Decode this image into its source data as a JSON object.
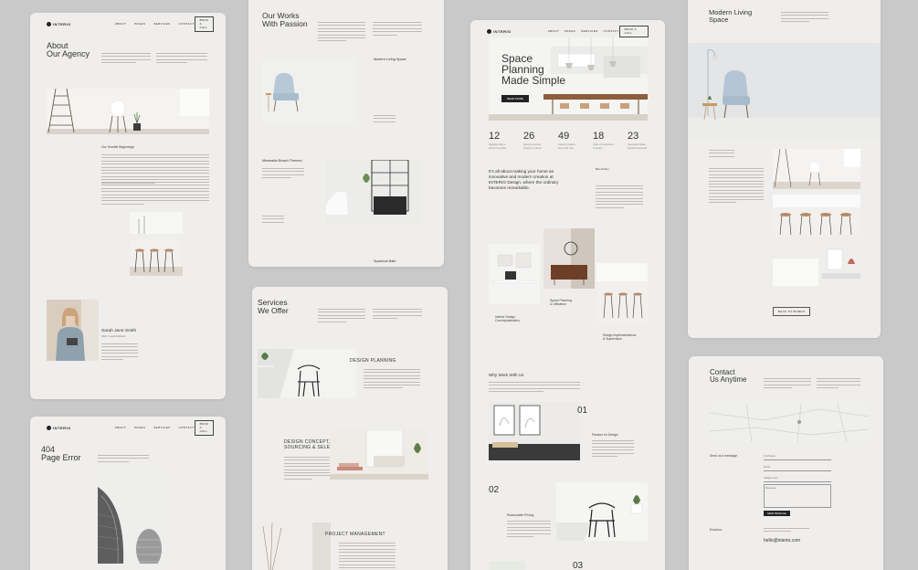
{
  "brand": {
    "logo": "INTERIO"
  },
  "nav": {
    "links": [
      "ABOUT",
      "PAGES",
      "SERVICES",
      "CONTACT"
    ],
    "cta": "BOOK A CALL"
  },
  "about": {
    "title_l1": "About",
    "title_l2": "Our Agency",
    "subheading": "Our Humble Beginnings",
    "person_name": "Sarah Jane Smith",
    "person_role": "CEO / Lead Architect"
  },
  "error404": {
    "title_l1": "404",
    "title_l2": "Page Error"
  },
  "works": {
    "title_l1": "Our Works",
    "title_l2": "With Passion",
    "project1": "Modern Living Space",
    "project2": "Minimalist Beach Themed",
    "project3": "Spacious Bath"
  },
  "services": {
    "title_l1": "Services",
    "title_l2": "We Offer",
    "s1": "DESIGN PLANNING",
    "s2_l1": "DESIGN CONCEPT,",
    "s2_l2": "SOURCING & SELECTION",
    "s3": "PROJECT MANAGEMENT"
  },
  "home": {
    "hero_l1": "Space",
    "hero_l2": "Planning",
    "hero_l3": "Made Simple",
    "hero_button": "READ MORE",
    "stats": [
      {
        "num": "12",
        "txt": "Satisfied clients across the globe"
      },
      {
        "num": "26",
        "txt": "Awards received during our career"
      },
      {
        "num": "49",
        "txt": "Custom projects done with care"
      },
      {
        "num": "18",
        "txt": "Years of experience in design"
      },
      {
        "num": "23",
        "txt": "Successful ideas launched and built"
      }
    ],
    "intro_l1": "It's all about making your home an",
    "intro_l2": "innovative and modern creation at",
    "intro_l3": "INTERIO Design, where the ordinary",
    "intro_l4": "becomes remarkable.",
    "side_heading": "Biomimikry",
    "tile1_l1": "Interior Design",
    "tile1_l2": "Conceptualization",
    "tile2_l1": "Space Planning",
    "tile2_l2": "& Utilization",
    "tile3_l1": "Design Implementations",
    "tile3_l2": "& Supervision",
    "why": "Why Work With Us",
    "n01": "01",
    "f1": "Passion for Design",
    "n02": "02",
    "f2": "Reasonable Pricing",
    "n03": "03"
  },
  "project": {
    "title_l1": "Modern Living",
    "title_l2": "Space",
    "button": "BACK TO WORKS"
  },
  "contact": {
    "title_l1": "Contact",
    "title_l2": "Us Anytime",
    "send": "Send us a message",
    "f_name": "Full Name",
    "f_email": "Email",
    "f_subject": "Subject here",
    "f_message": "Message",
    "submit": "SEND MESSAGE",
    "email_label": "Email us",
    "email": "hello@interio.com"
  }
}
